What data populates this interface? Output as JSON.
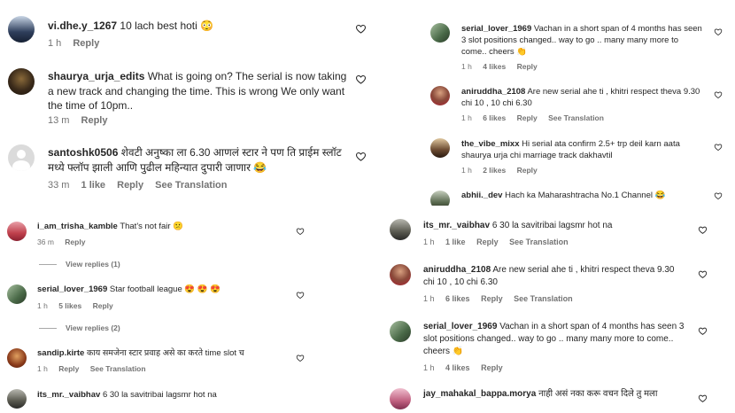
{
  "comments": [
    {
      "user": "vi.dhe.y_1267",
      "text": "10 lach best hoti",
      "time": "1 h",
      "reply": "Reply",
      "emoji": "😳"
    },
    {
      "user": "shaurya_urja_edits",
      "text": "What is going on? The serial is now taking a new track and changing the time. This is wrong We only want the time of 10pm..",
      "time": "13 m",
      "reply": "Reply"
    },
    {
      "user": "santoshk0506",
      "text": "शेवटी अनुष्का ला 6.30 आणलं स्टार ने पण ति प्राईम स्लॉट मध्ये फ्लॉप झाली आणि पुढील महिन्यात दुपारी जाणार",
      "time": "33 m",
      "likes": "1 like",
      "reply": "Reply",
      "translation": "See Translation",
      "emoji": "😂"
    },
    {
      "user": "i_am_trisha_kamble",
      "text": "That's not fair",
      "time": "36 m",
      "reply": "Reply",
      "emoji": "😕",
      "view_replies": "View replies (1)"
    },
    {
      "user": "serial_lover_1969",
      "text": "Star football league",
      "time": "1 h",
      "likes": "5 likes",
      "reply": "Reply",
      "emoji": "😍 😍 😍",
      "view_replies": "View replies (2)"
    },
    {
      "user": "sandip.kirte",
      "text": "काय समजेना स्टार प्रवाह असे का करते time slot च",
      "time": "1 h",
      "reply": "Reply",
      "translation": "See Translation"
    },
    {
      "user": "its_mr._vaibhav",
      "text": "6 30 la savitribai lagsmr hot na"
    },
    {
      "user": "serial_lover_1969",
      "text": "Vachan in a short span of 4 months has seen 3 slot positions changed.. way to go .. many many more to come.. cheers",
      "time": "1 h",
      "likes": "4 likes",
      "reply": "Reply",
      "emoji": "👏"
    },
    {
      "user": "aniruddha_2108",
      "text": "Are new serial ahe ti , khitri respect theva 9.30 chi 10 , 10 chi 6.30",
      "time": "1 h",
      "likes": "6 likes",
      "reply": "Reply",
      "translation": "See Translation"
    },
    {
      "user": "the_vibe_mixx",
      "text": "Hi serial ata confirm 2.5+ trp deil karn aata shaurya urja chi marriage track dakhavtil",
      "time": "1 h",
      "likes": "2 likes",
      "reply": "Reply"
    },
    {
      "user": "abhii._dev",
      "text": "Hach ka Maharashtracha No.1 Channel",
      "emoji": "😂"
    },
    {
      "user": "its_mr._vaibhav",
      "text": "6 30 la savitribai lagsmr hot na",
      "time": "1 h",
      "likes": "1 like",
      "reply": "Reply",
      "translation": "See Translation"
    },
    {
      "user": "aniruddha_2108",
      "text": "Are new serial ahe ti , khitri respect theva 9.30 chi 10 , 10 chi 6.30",
      "time": "1 h",
      "likes": "6 likes",
      "reply": "Reply",
      "translation": "See Translation"
    },
    {
      "user": "serial_lover_1969",
      "text": "Vachan in a short span of 4 months has seen 3 slot positions changed.. way to go .. many many more to come.. cheers",
      "time": "1 h",
      "likes": "4 likes",
      "reply": "Reply",
      "emoji": "👏"
    },
    {
      "user": "jay_mahakal_bappa.morya",
      "text": "नाही असं नका करू वचन दिले तु मला"
    }
  ],
  "colors": {
    "text": "#262626",
    "meta": "#737373",
    "heart": "#262626"
  },
  "icons": {
    "like": "heart-outline-icon"
  }
}
